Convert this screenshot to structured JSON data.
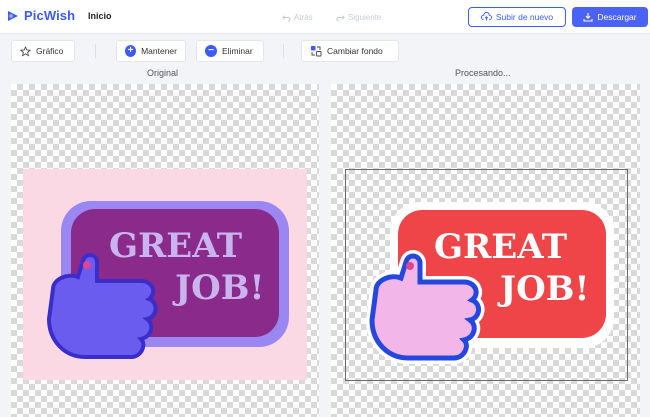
{
  "brand": {
    "name": "PicWish",
    "color": "#3b5bfd"
  },
  "nav": {
    "home": "Inicio"
  },
  "history": {
    "undo": "Atrás",
    "redo": "Siguiente"
  },
  "actions": {
    "upload": "Subir de nuevo",
    "download": "Descargar"
  },
  "toolbar": {
    "graphic": "Gráfico",
    "keep": "Mantener",
    "erase": "Eliminar",
    "change_bg": "Cambiar fondo"
  },
  "panels": {
    "original": "Original",
    "processing": "Procesando..."
  },
  "image_text": {
    "line1": "GREAT",
    "line2": "JOB!"
  },
  "icons": [
    "logo-icon",
    "undo-icon",
    "redo-icon",
    "upload-icon",
    "download-icon",
    "graphic-icon",
    "plus-icon",
    "minus-icon",
    "change-bg-icon"
  ]
}
